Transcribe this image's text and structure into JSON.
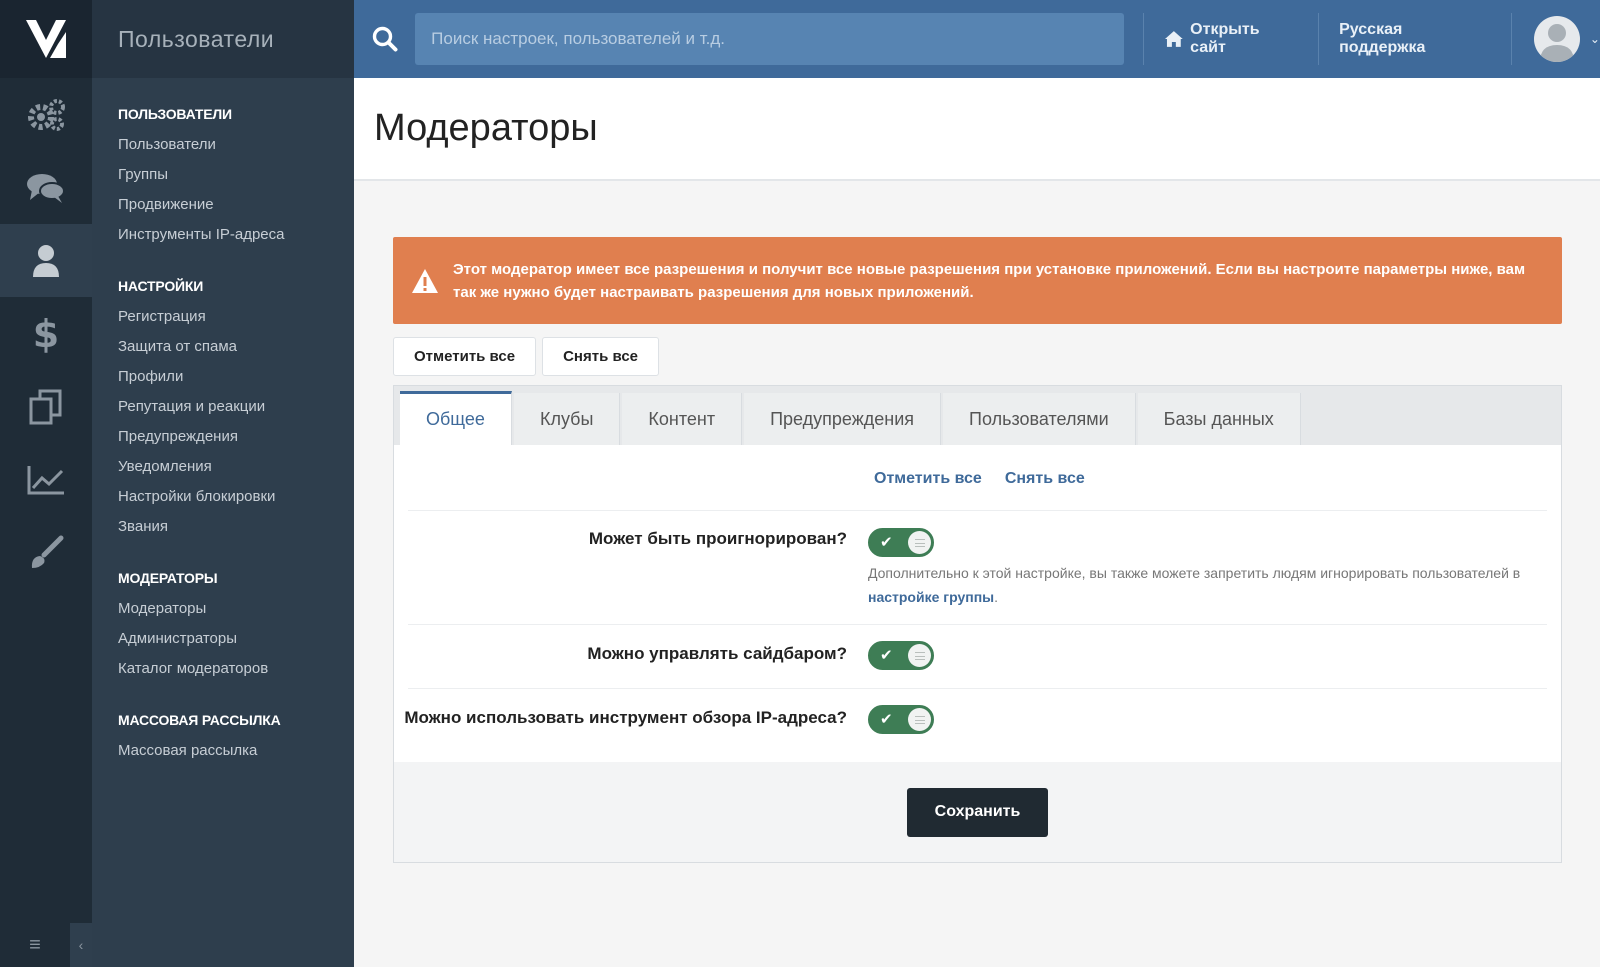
{
  "app": {
    "section_title": "Пользователи"
  },
  "rail": {
    "icons": [
      "logo-icon",
      "gears-icon",
      "chat-icon",
      "user-icon",
      "dollar-icon",
      "pages-icon",
      "chart-icon",
      "brush-icon",
      "menu-icon",
      "collapse-icon"
    ],
    "dollar_glyph": "$",
    "burger_glyph": "≡",
    "collapse_glyph": "‹"
  },
  "sidebar": {
    "groups": [
      {
        "title": "Пользователи",
        "items": [
          "Пользователи",
          "Группы",
          "Продвижение",
          "Инструменты IP-адреса"
        ]
      },
      {
        "title": "Настройки",
        "items": [
          "Регистрация",
          "Защита от спама",
          "Профили",
          "Репутация и реакции",
          "Предупреждения",
          "Уведомления",
          "Настройки блокировки",
          "Звания"
        ]
      },
      {
        "title": "Модераторы",
        "items": [
          "Модераторы",
          "Администраторы",
          "Каталог модераторов"
        ]
      },
      {
        "title": "Массовая рассылка",
        "items": [
          "Массовая рассылка"
        ]
      }
    ]
  },
  "topbar": {
    "search_placeholder": "Поиск настроек, пользователей и т.д.",
    "open_site": "Открыть сайт",
    "support": "Русская поддержка",
    "chevron_glyph": "⌄"
  },
  "page": {
    "title": "Модераторы"
  },
  "alert": {
    "text": "Этот модератор имеет все разрешения и получит все новые разрешения при установке приложений. Если вы настроите параметры ниже, вам так же нужно будет настраивать разрешения для новых приложений."
  },
  "actions": {
    "check_all": "Отметить все",
    "uncheck_all": "Снять все"
  },
  "tabs": [
    "Общее",
    "Клубы",
    "Контент",
    "Предупреждения",
    "Пользователями",
    "Базы данных"
  ],
  "active_tab": "Общее",
  "quick": {
    "check_all": "Отметить все",
    "uncheck_all": "Снять все"
  },
  "settings": [
    {
      "label": "Может быть проигнорирован?",
      "enabled": true,
      "hint_prefix": "Дополнительно к этой настройке, вы также можете запретить людям игнорировать пользователей в ",
      "hint_link": "настройке группы",
      "hint_suffix": "."
    },
    {
      "label": "Можно управлять сайдбаром?",
      "enabled": true
    },
    {
      "label": "Можно использовать инструмент обзора IP-адреса?",
      "enabled": true
    }
  ],
  "toggle_glyph": "✔",
  "save_label": "Сохранить",
  "colors": {
    "accent": "#3f6a9a",
    "alert": "#e07f4f",
    "toggle_on": "#3e7d55",
    "sidebar": "#2e3e4d",
    "rail": "#1f2c37"
  }
}
